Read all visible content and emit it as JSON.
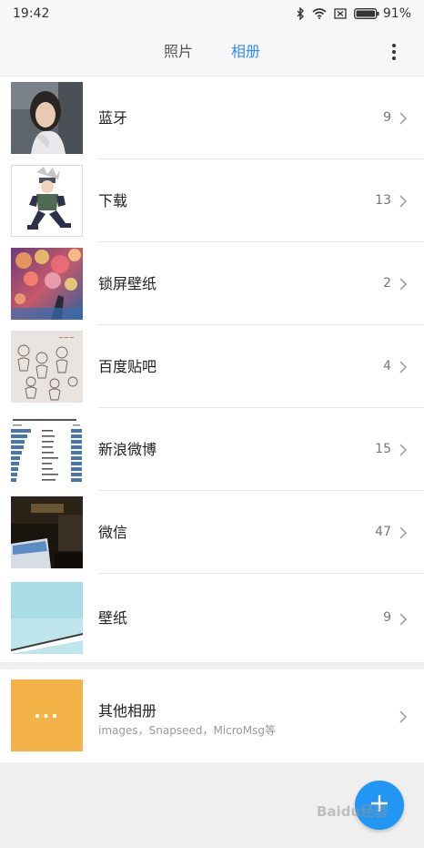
{
  "status_bar": {
    "time": "19:42",
    "battery_percent": "91%",
    "icons": [
      "bluetooth-icon",
      "wifi-icon",
      "no-sim-icon",
      "battery-icon"
    ]
  },
  "header": {
    "tabs": [
      {
        "label": "照片",
        "active": false
      },
      {
        "label": "相册",
        "active": true
      }
    ],
    "accent_color": "#2f8df3",
    "menu_icon": "more-vertical-icon"
  },
  "albums": [
    {
      "name": "蓝牙",
      "count": "9"
    },
    {
      "name": "下载",
      "count": "13"
    },
    {
      "name": "锁屏壁纸",
      "count": "2"
    },
    {
      "name": "百度贴吧",
      "count": "4"
    },
    {
      "name": "新浪微博",
      "count": "15"
    },
    {
      "name": "微信",
      "count": "47"
    },
    {
      "name": "壁纸",
      "count": "9"
    }
  ],
  "other_albums": {
    "name": "其他相册",
    "subtitle": "images，Snapseed，MicroMsg等",
    "thumb_glyph": "···",
    "thumb_color": "#f3b349"
  },
  "fab": {
    "icon": "plus-icon",
    "color": "#2196f3"
  },
  "watermark": "Baidu经验"
}
